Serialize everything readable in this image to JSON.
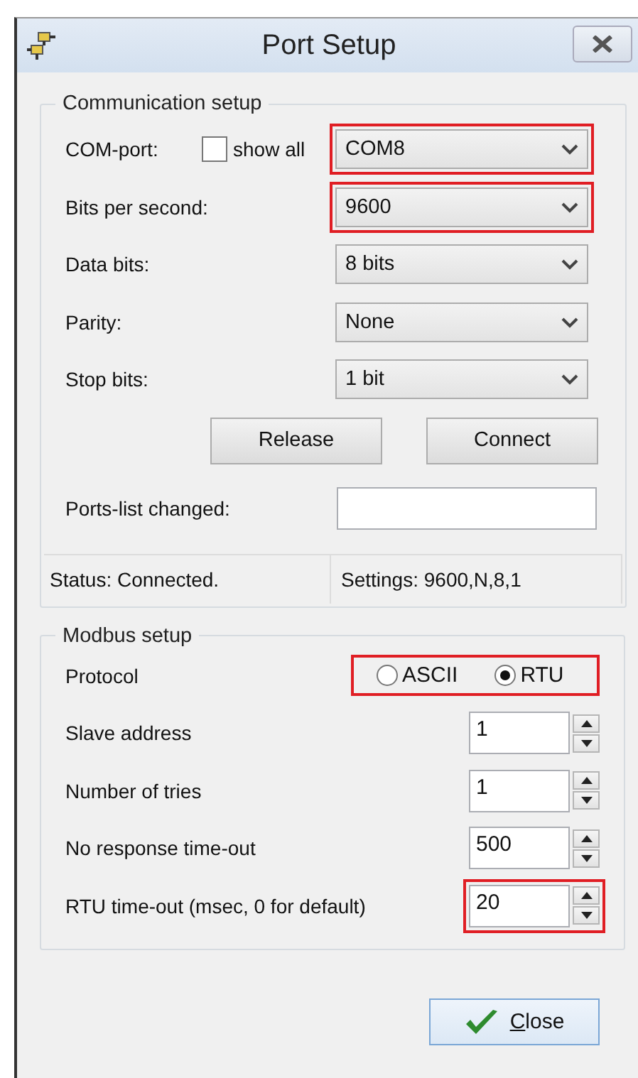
{
  "window": {
    "title": "Port Setup"
  },
  "communication_setup": {
    "title": "Communication setup",
    "com_port": {
      "label": "COM-port:",
      "show_all": {
        "label": "show all",
        "checked": false
      },
      "value": "COM8",
      "highlighted": true
    },
    "fields": [
      {
        "label": "Bits per second:",
        "value": "9600",
        "highlighted": true
      },
      {
        "label": "Data bits:",
        "value": "8 bits",
        "highlighted": false
      },
      {
        "label": "Parity:",
        "value": "None",
        "highlighted": false
      },
      {
        "label": "Stop bits:",
        "value": "1 bit",
        "highlighted": false
      }
    ],
    "buttons": [
      {
        "label": "Release"
      },
      {
        "label": "Connect"
      }
    ],
    "ports_list_changed": {
      "label": "Ports-list changed:"
    },
    "status_bar": [
      "Status: Connected.",
      "Settings: 9600,N,8,1"
    ]
  },
  "modbus_setup": {
    "title": "Modbus setup",
    "protocol": {
      "label": "Protocol",
      "highlighted": true,
      "options": [
        {
          "label": "ASCII",
          "selected": false
        },
        {
          "label": "RTU",
          "selected": true
        }
      ]
    },
    "fields": [
      {
        "label": "Slave address",
        "value": "1",
        "highlighted": false
      },
      {
        "label": "Number of tries",
        "value": "1",
        "highlighted": false
      },
      {
        "label": "No response time-out",
        "value": "500",
        "highlighted": false
      },
      {
        "label": "RTU time-out (msec, 0 for default)",
        "value": "20",
        "highlighted": true
      }
    ]
  },
  "close_button": {
    "label": "Close",
    "mnemonic_underlined": true
  }
}
